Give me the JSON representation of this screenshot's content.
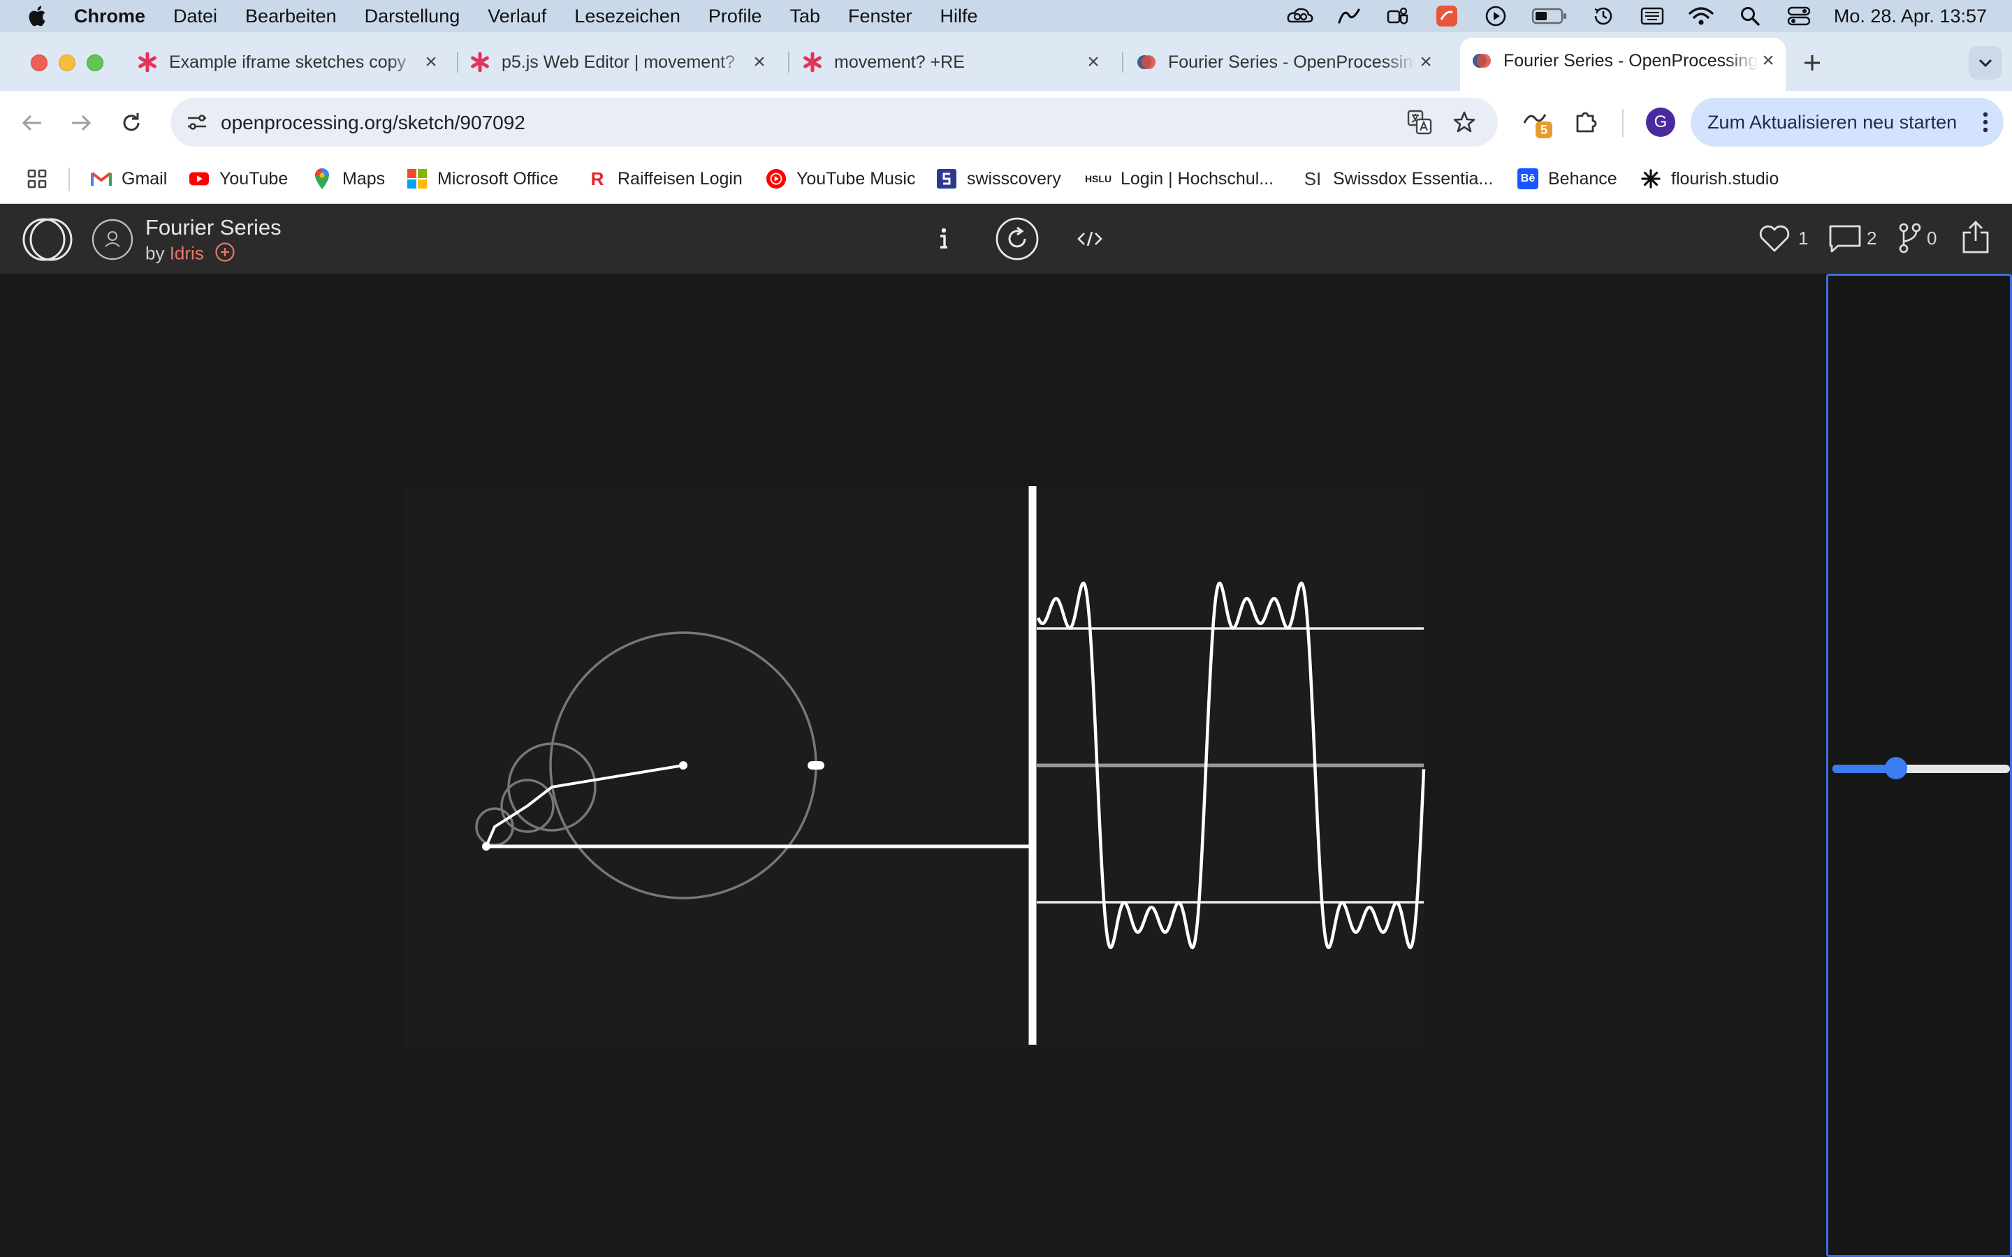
{
  "menubar": {
    "app": "Chrome",
    "items": [
      "Datei",
      "Bearbeiten",
      "Darstellung",
      "Verlauf",
      "Lesezeichen",
      "Profile",
      "Tab",
      "Fenster",
      "Hilfe"
    ],
    "clock": "Mo. 28. Apr.  13:57",
    "status_icons": [
      "creative-cloud-icon",
      "stylus-icon",
      "teams-icon",
      "app-badge-icon",
      "play-icon",
      "battery-icon",
      "time-machine-icon",
      "input-source-icon",
      "wifi-icon",
      "spotlight-icon",
      "control-center-icon"
    ]
  },
  "tabs": [
    {
      "title": "Example iframe sketches copy",
      "favicon": "asterisk",
      "active": false
    },
    {
      "title": "p5.js Web Editor | movement?",
      "favicon": "asterisk",
      "active": false
    },
    {
      "title": "movement? +RE",
      "favicon": "asterisk",
      "active": false
    },
    {
      "title": "Fourier Series - OpenProcessing",
      "favicon": "op",
      "active": false
    },
    {
      "title": "Fourier Series - OpenProcessing",
      "favicon": "op",
      "active": true
    }
  ],
  "toolbar": {
    "url": "openprocessing.org/sketch/907092",
    "extension_badge": "5",
    "profile_initial": "G",
    "update_label": "Zum Aktualisieren neu starten"
  },
  "bookmarks": [
    {
      "label": "Gmail",
      "icon": "gmail-icon"
    },
    {
      "label": "YouTube",
      "icon": "youtube-icon"
    },
    {
      "label": "Maps",
      "icon": "maps-icon"
    },
    {
      "label": "Microsoft Office",
      "icon": "office-icon"
    },
    {
      "label": "Raiffeisen Login",
      "icon": "raiffeisen-icon"
    },
    {
      "label": "YouTube Music",
      "icon": "youtube-music-icon"
    },
    {
      "label": "swisscovery",
      "icon": "swisscovery-icon"
    },
    {
      "label": "Login | Hochschul...",
      "icon": "hslu-icon",
      "icon_text": "HSLU"
    },
    {
      "label": "Swissdox Essentia...",
      "icon": "swissdox-icon",
      "icon_text": "SI"
    },
    {
      "label": "Behance",
      "icon": "behance-icon",
      "icon_text": "Bē"
    },
    {
      "label": "flourish.studio",
      "icon": "flourish-icon"
    }
  ],
  "sketch_header": {
    "title": "Fourier Series",
    "by": "by",
    "author": "Idris",
    "likes": "1",
    "comments": "2",
    "forks": "0"
  },
  "slider": {
    "value": 0.36
  },
  "colors": {
    "page_bg": "#191919",
    "sketch_bg": "#1c1c1c",
    "header_bg": "#2b2b2b",
    "author": "#e8776a",
    "slider_accent": "#3a7cf2",
    "tab_strip": "#dde8f4",
    "menubar": "#c9d9ea"
  }
}
